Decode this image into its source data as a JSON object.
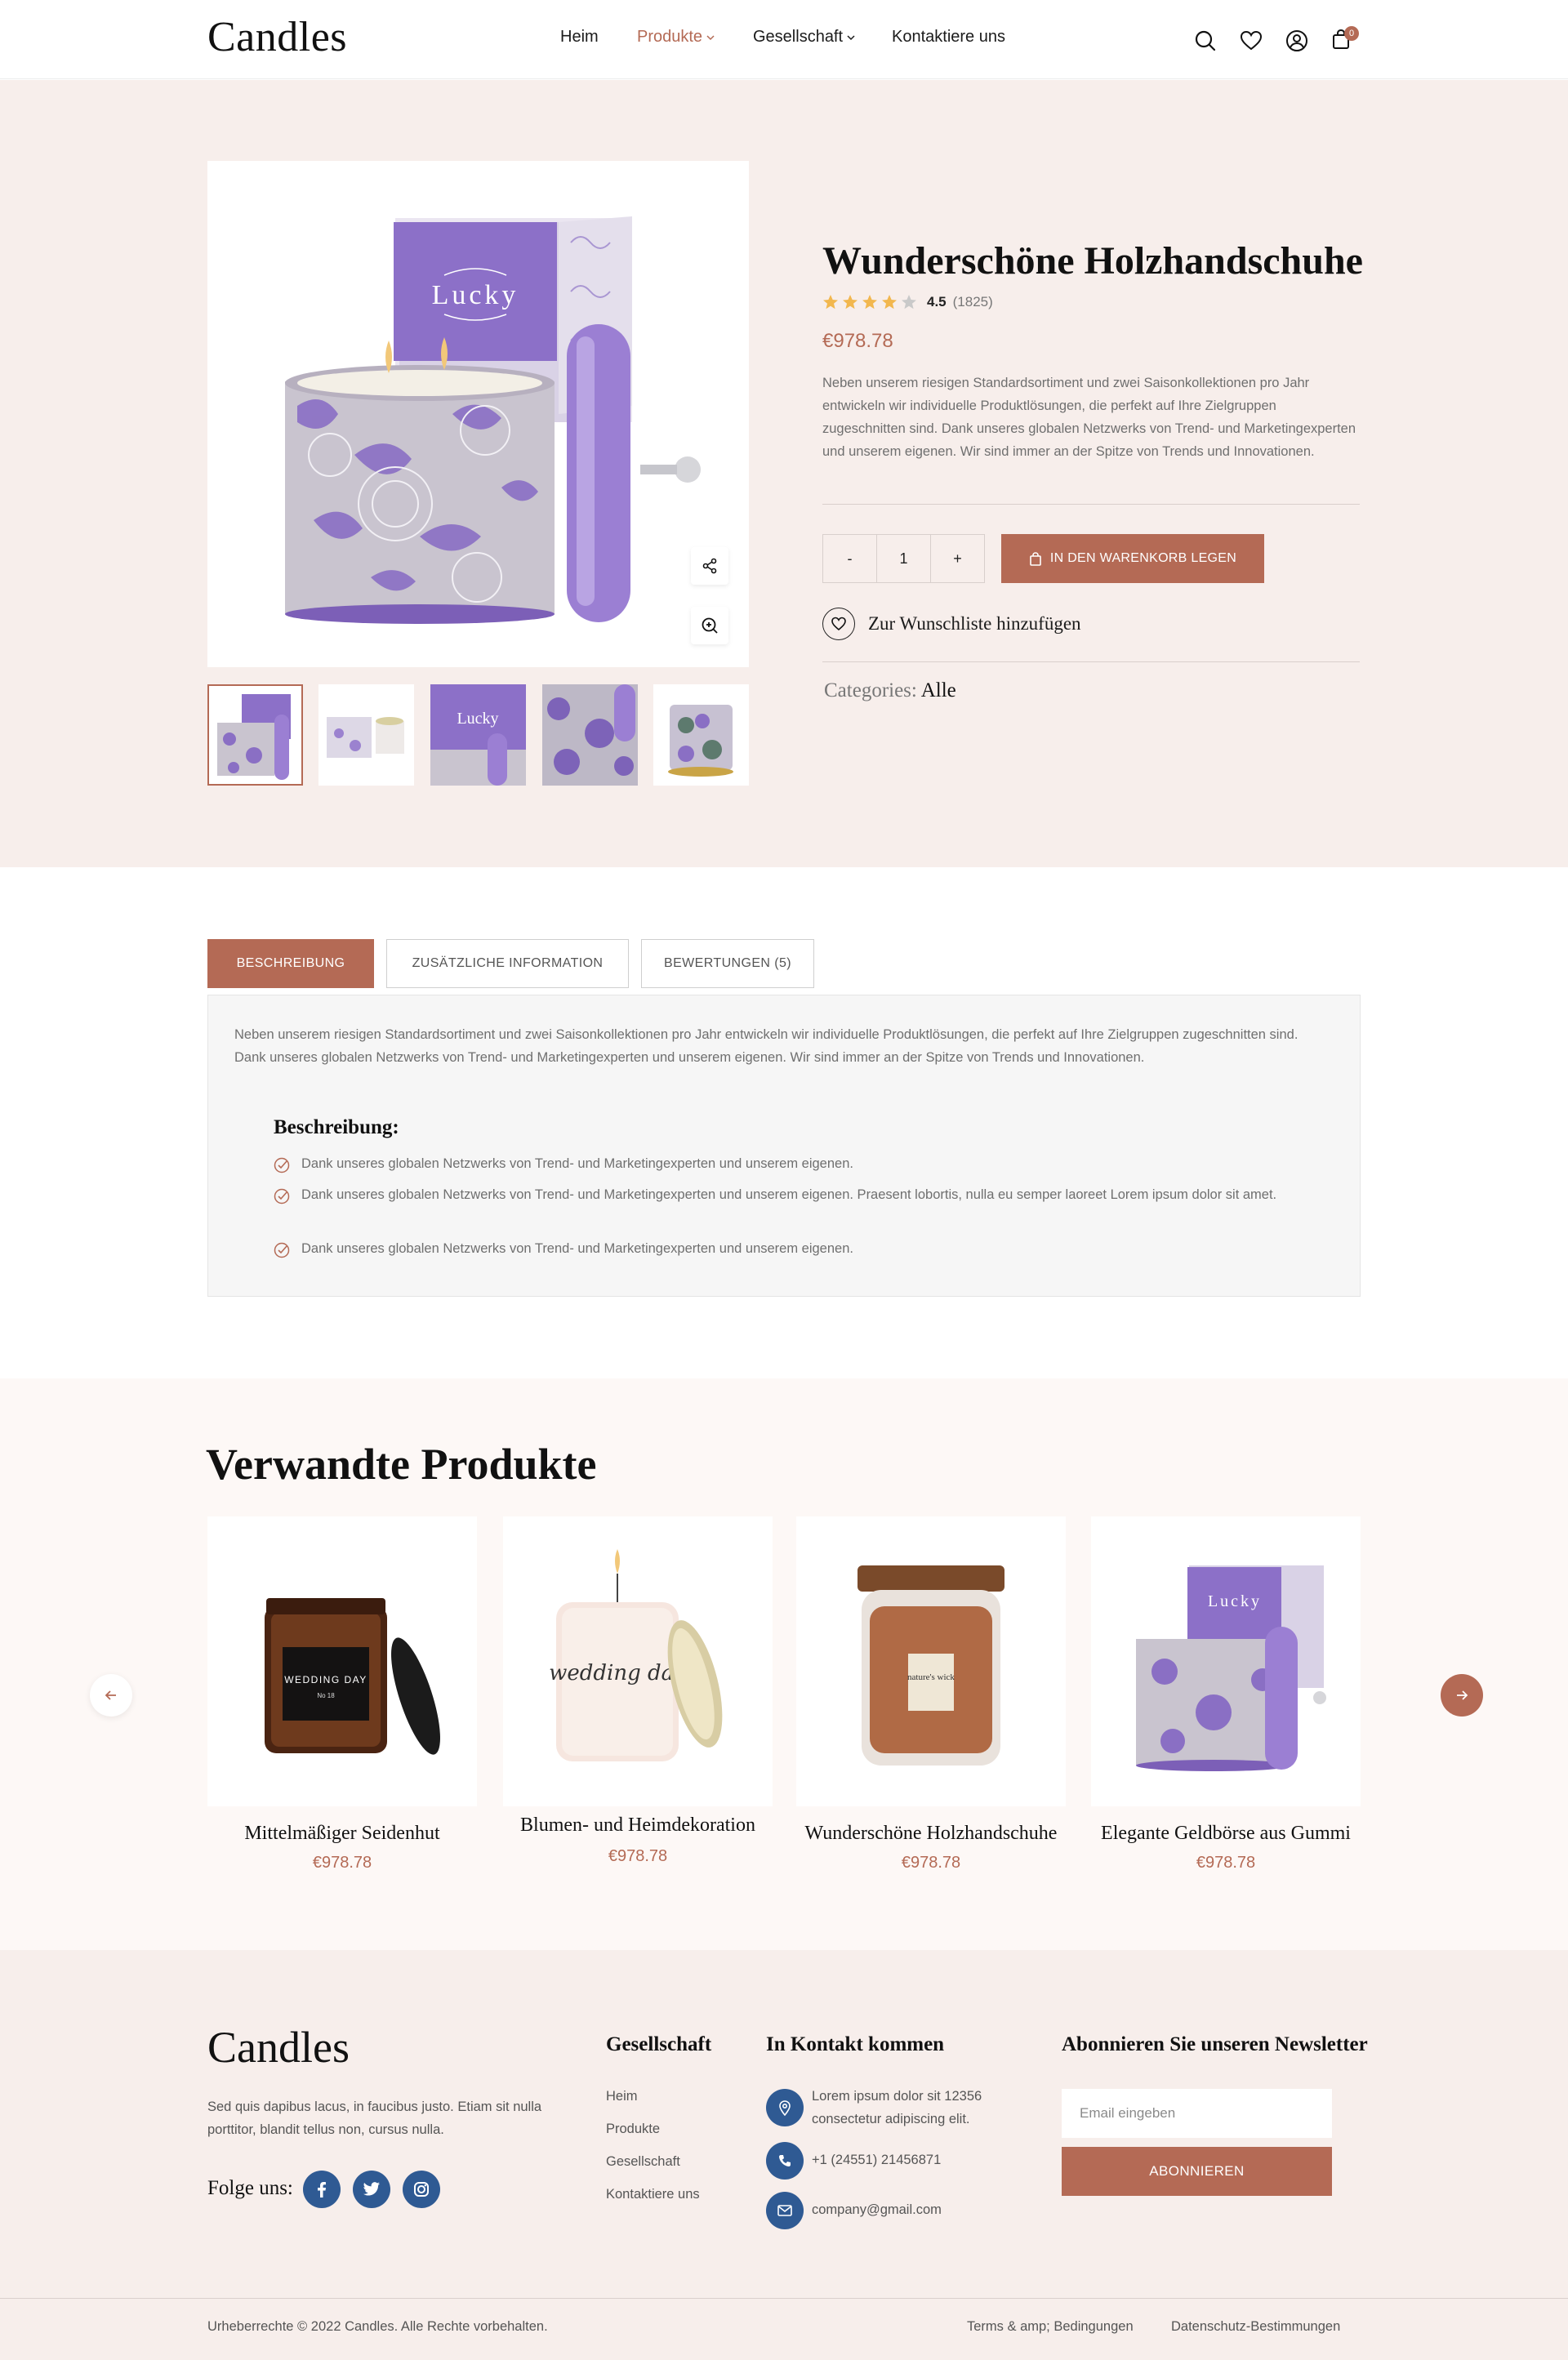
{
  "header": {
    "logo": "Candles",
    "nav": [
      {
        "label": "Heim"
      },
      {
        "label": "Produkte"
      },
      {
        "label": "Gesellschaft"
      },
      {
        "label": "Kontaktiere uns"
      }
    ],
    "cart_count": "0",
    "icons": [
      "search-icon",
      "heart-icon",
      "user-icon",
      "bag-icon"
    ]
  },
  "product": {
    "title": "Wunderschöne Holzhandschuhe",
    "rating": "4.5",
    "rating_count": "(1825)",
    "stars_filled": 4,
    "price": "€978.78",
    "description": "Neben unserem riesigen Standardsortiment und zwei Saisonkollektionen pro Jahr entwickeln wir individuelle Produktlösungen, die perfekt auf Ihre Zielgruppen zugeschnitten sind. Dank unseres globalen Netzwerks von Trend- und Marketingexperten und unserem eigenen. Wir sind immer an der Spitze von Trends und Innovationen.",
    "qty_minus": "-",
    "qty_value": "1",
    "qty_plus": "+",
    "cart_button": "IN DEN WARENKORB LEGEN",
    "wishlist": "Zur Wunschliste hinzufügen",
    "categories_label": "Categories:",
    "categories_value": "Alle",
    "image_label": "Lucky"
  },
  "tabs": [
    {
      "label": "BESCHREIBUNG"
    },
    {
      "label": "ZUSÄTZLICHE INFORMATION"
    },
    {
      "label": "BEWERTUNGEN (5)"
    }
  ],
  "description_panel": {
    "text": "Neben unserem riesigen Standardsortiment und zwei Saisonkollektionen pro Jahr entwickeln wir individuelle Produktlösungen, die perfekt auf Ihre Zielgruppen zugeschnitten sind. Dank unseres globalen Netzwerks von Trend- und Marketingexperten und unserem eigenen. Wir sind immer an der Spitze von Trends und Innovationen.",
    "heading": "Beschreibung:",
    "bullets": [
      "Dank unseres globalen Netzwerks von Trend- und Marketingexperten und unserem eigenen.",
      "Dank unseres globalen Netzwerks von Trend- und Marketingexperten und unserem eigenen. Praesent lobortis, nulla eu semper laoreet Lorem ipsum dolor sit amet.",
      "Dank unseres globalen Netzwerks von Trend- und Marketingexperten und unserem eigenen."
    ]
  },
  "related": {
    "title": "Verwandte Produkte",
    "items": [
      {
        "name": "Mittelmäßiger Seidenhut",
        "price": "€978.78",
        "jar_text": "WEDDING DAY",
        "jar_sub": "No 18"
      },
      {
        "name": "Blumen- und Heimdekoration",
        "price": "€978.78",
        "jar_text": "wedding day"
      },
      {
        "name": "Wunderschöne Holzhandschuhe",
        "price": "€978.78",
        "jar_text": "nature's wick"
      },
      {
        "name": "Elegante Geldbörse aus Gummi",
        "price": "€978.78",
        "jar_text": "Lucky"
      }
    ]
  },
  "footer": {
    "logo": "Candles",
    "about": "Sed quis dapibus lacus, in faucibus justo. Etiam sit nulla porttitor, blandit tellus non, cursus nulla.",
    "follow": "Folge uns:",
    "company_heading": "Gesellschaft",
    "company_links": [
      "Heim",
      "Produkte",
      "Gesellschaft",
      "Kontaktiere uns"
    ],
    "contact_heading": "In Kontakt kommen",
    "address": "Lorem ipsum dolor sit 12356 consectetur adipiscing elit.",
    "phone": "+1 (24551) 21456871",
    "email": "company@gmail.com",
    "newsletter_heading": "Abonnieren Sie unseren Newsletter",
    "email_placeholder": "Email eingeben",
    "subscribe": "ABONNIEREN",
    "copyright": "Urheberrechte © 2022 Candles. Alle Rechte vorbehalten.",
    "terms": "Terms & amp; Bedingungen",
    "privacy": "Datenschutz-Bestimmungen"
  },
  "colors": {
    "accent": "#b46a55",
    "section_bg": "#f7eeeb",
    "social": "#2f5a93",
    "lavender": "#8b6fc6"
  }
}
